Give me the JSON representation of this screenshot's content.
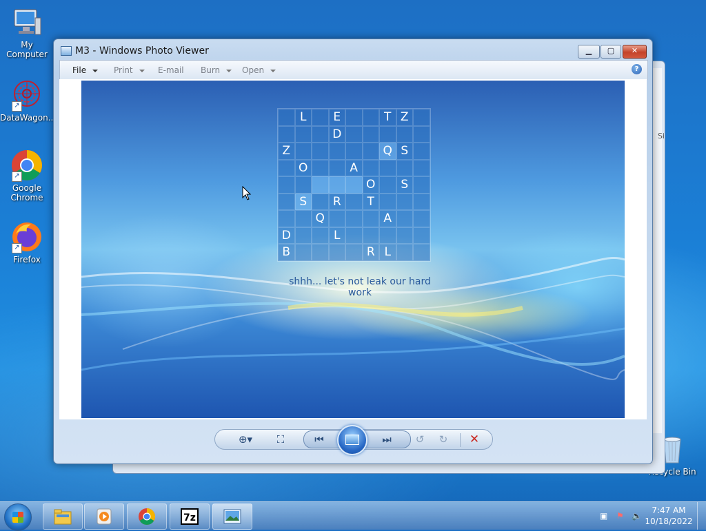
{
  "desktop": {
    "icons": [
      {
        "label": "My Computer"
      },
      {
        "label": "DataWagon..."
      },
      {
        "label": "Google Chrome"
      },
      {
        "label": "Firefox"
      },
      {
        "label": "Recycle Bin"
      }
    ],
    "background_window_fragment": "Si"
  },
  "window": {
    "title": "M3 - Windows Photo Viewer",
    "menu": {
      "file": "File",
      "print": "Print",
      "email": "E-mail",
      "burn": "Burn",
      "open": "Open"
    },
    "help": "?",
    "photo": {
      "grid_rows": [
        [
          "",
          "L",
          "",
          "E",
          "",
          "",
          "T",
          "Z",
          ""
        ],
        [
          "",
          "",
          "",
          "D",
          "",
          "",
          "",
          "",
          ""
        ],
        [
          "Z",
          "",
          "",
          "",
          "",
          "",
          "Q",
          "S",
          ""
        ],
        [
          "",
          "O",
          "",
          "",
          "A",
          "",
          "",
          "",
          ""
        ],
        [
          "",
          "",
          "",
          "",
          "",
          "O",
          "",
          "S",
          ""
        ],
        [
          "",
          "S",
          "",
          "R",
          "",
          "T",
          "",
          "",
          ""
        ],
        [
          "",
          "",
          "Q",
          "",
          "",
          "",
          "A",
          "",
          ""
        ],
        [
          "D",
          "",
          "",
          "L",
          "",
          "",
          "",
          "",
          ""
        ],
        [
          "B",
          "",
          "",
          "",
          "",
          "R",
          "L",
          "",
          ""
        ]
      ],
      "caption": "shhh... let's not leak our hard work"
    }
  },
  "taskbar": {
    "clock_time": "7:47 AM",
    "clock_date": "10/18/2022"
  },
  "colors": {
    "desktop_blue": "#1b7fd6",
    "close_red": "#c4432a",
    "delete_red": "#c9261e"
  }
}
